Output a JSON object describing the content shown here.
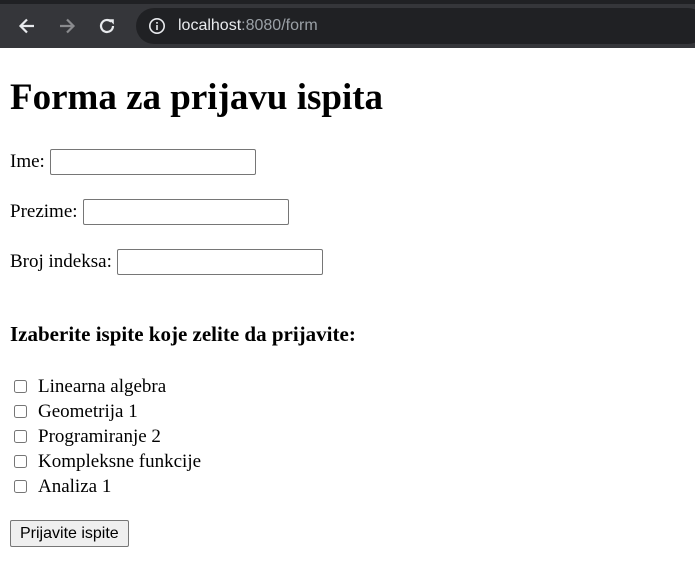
{
  "browser": {
    "url_host": "localhost",
    "url_rest": ":8080/form",
    "icons": [
      "back-arrow-icon",
      "forward-arrow-icon",
      "reload-icon",
      "info-icon"
    ]
  },
  "form": {
    "title": "Forma za prijavu ispita",
    "fields": [
      {
        "label": "Ime:",
        "value": ""
      },
      {
        "label": "Prezime:",
        "value": ""
      },
      {
        "label": "Broj indeksa:",
        "value": ""
      }
    ],
    "exams_heading": "Izaberite ispite koje zelite da prijavite:",
    "exams": [
      {
        "label": "Linearna algebra",
        "checked": false
      },
      {
        "label": "Geometrija 1",
        "checked": false
      },
      {
        "label": "Programiranje 2",
        "checked": false
      },
      {
        "label": "Kompleksne funkcije",
        "checked": false
      },
      {
        "label": "Analiza 1",
        "checked": false
      }
    ],
    "submit_label": "Prijavite ispite"
  }
}
